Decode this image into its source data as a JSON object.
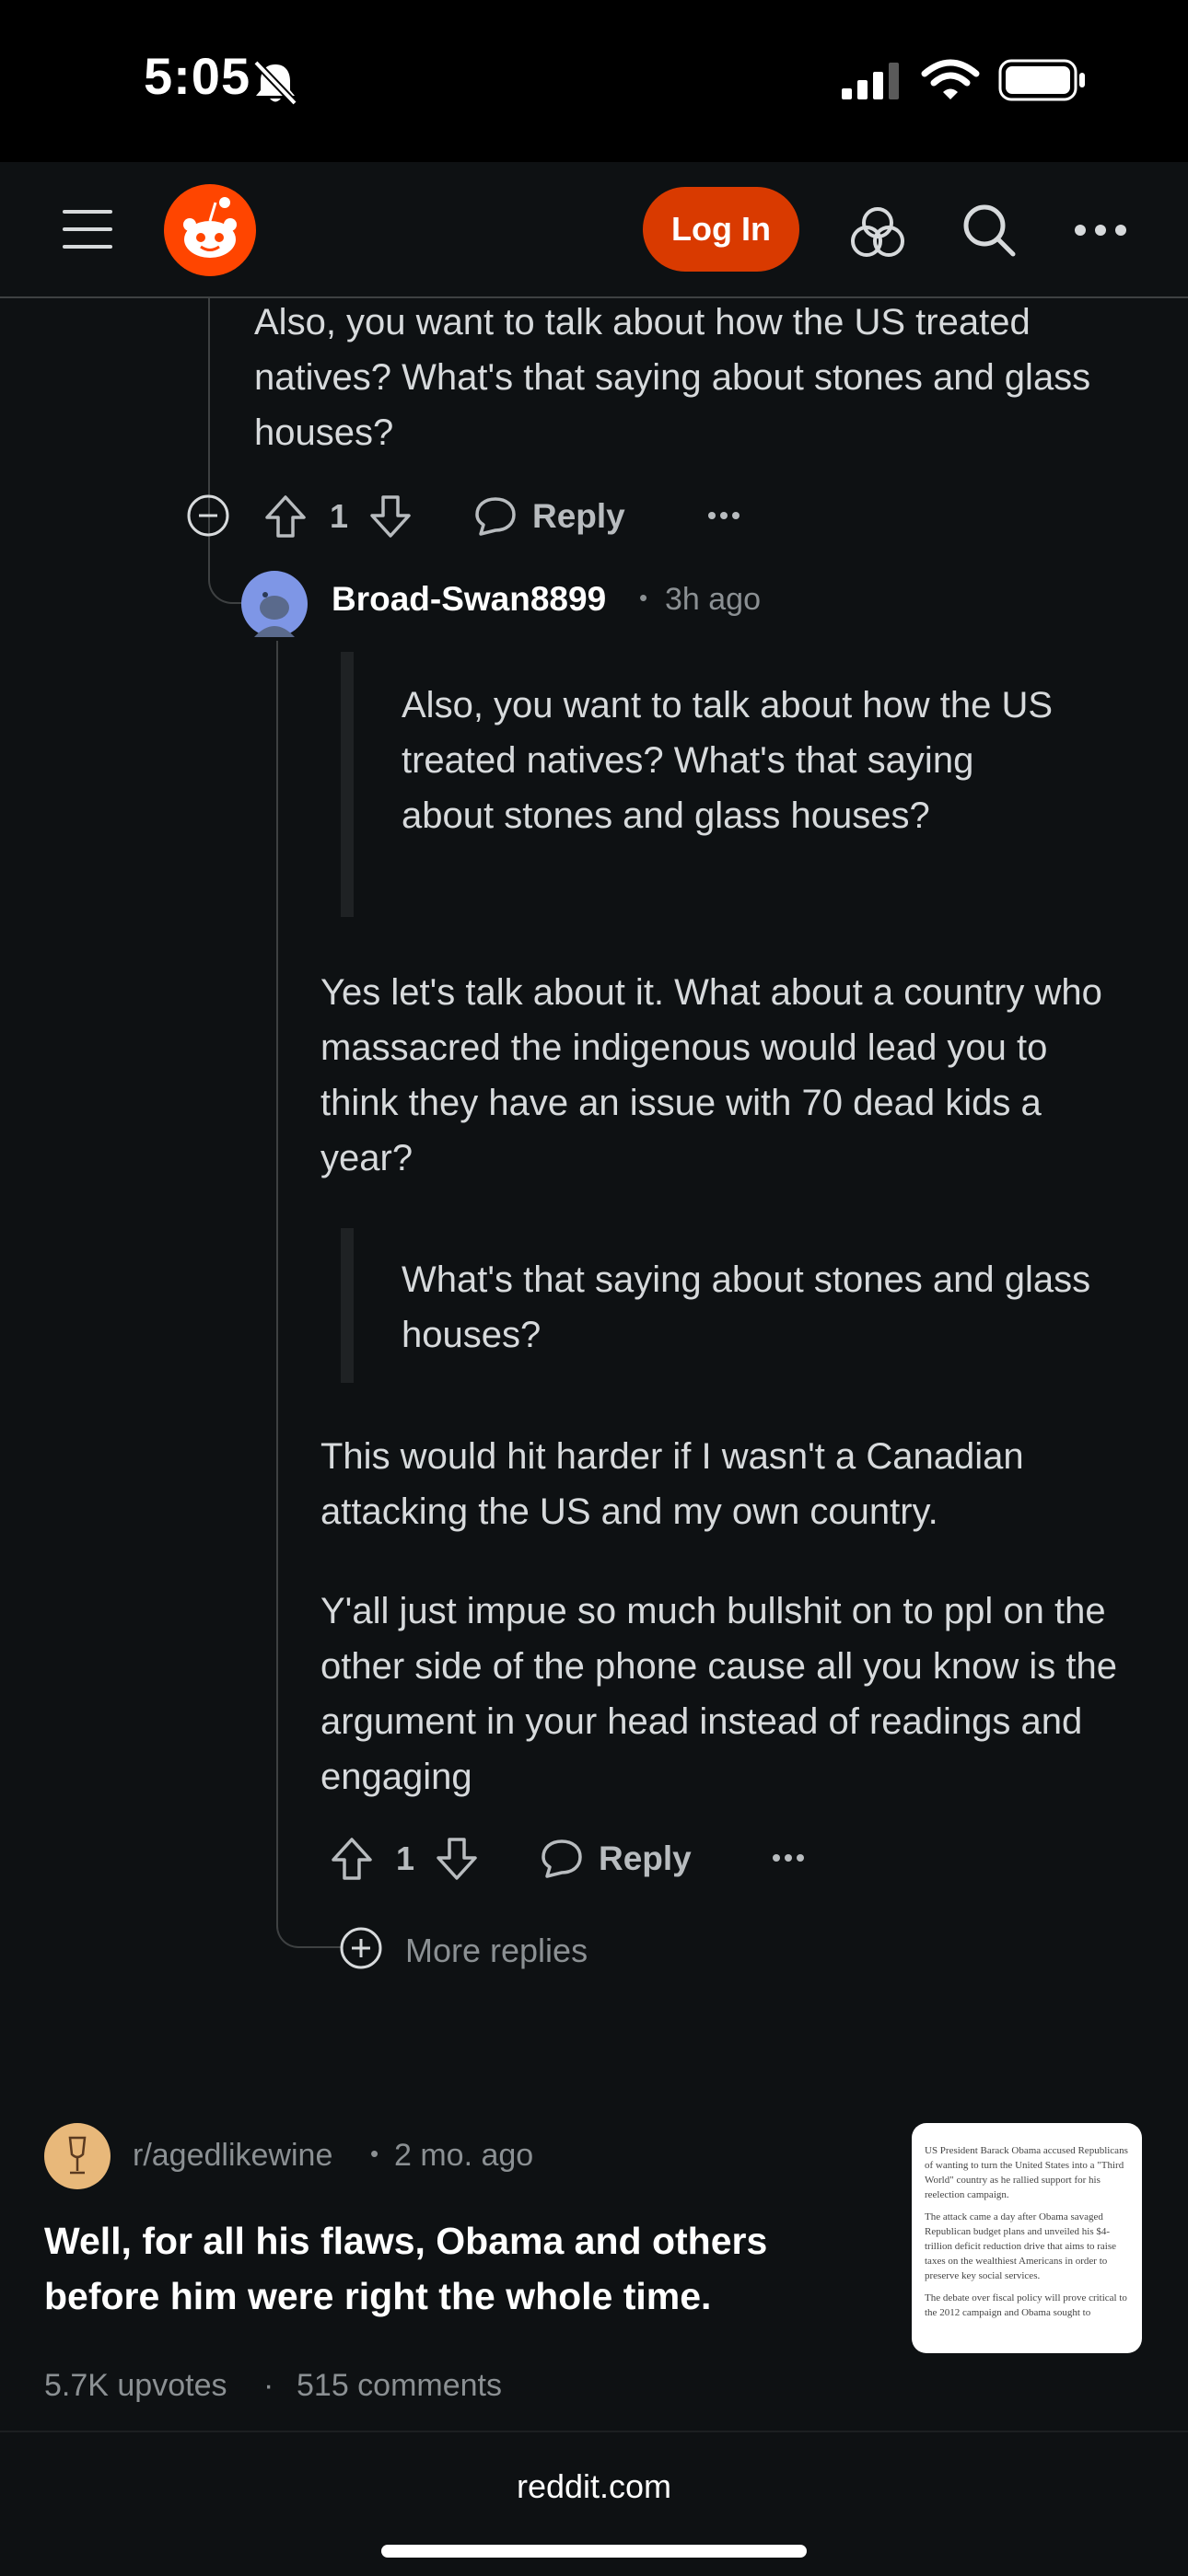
{
  "status": {
    "time": "5:05"
  },
  "header": {
    "login_label": "Log In"
  },
  "parent_comment": {
    "text": "Also, you want to talk about how the US treated natives? What's that saying about stones and glass houses?",
    "votes": "1",
    "reply_label": "Reply",
    "more": "···"
  },
  "reply": {
    "author": "Broad-Swan8899",
    "dot": "•",
    "time": "3h ago",
    "quote1": "Also, you want to talk about how the US treated natives? What's that saying about stones and glass houses?",
    "para1": "Yes let's talk about it. What about a country who massacred the indigenous would lead you to think they have an issue with 70 dead kids a year?",
    "quote2": "What's that saying about stones and glass houses?",
    "para2": "This would hit harder if I wasn't a Canadian attacking the US and my own country.",
    "para3": "Y'all just impue so much bullshit on to ppl on the other side of the phone cause all you know is the argument in your head instead of readings and engaging",
    "votes": "1",
    "reply_label": "Reply",
    "more": "···",
    "more_replies": "More replies"
  },
  "related_post": {
    "subreddit": "r/agedlikewine",
    "dot": "•",
    "age": "2 mo. ago",
    "title": "Well, for all his flaws, Obama and others before him were right the whole time.",
    "upvotes": "5.7K upvotes",
    "sep": "·",
    "comments": "515 comments",
    "thumbnail_text": {
      "p1": "US President Barack Obama accused Republicans of wanting to turn the United States into a \"Third World\" country as he rallied support for his reelection campaign.",
      "p2": "The attack came a day after Obama savaged Republican budget plans and unveiled his $4-trillion deficit reduction drive that aims to raise taxes on the wealthiest Americans in order to preserve key social services.",
      "p3": "The debate over fiscal policy will prove critical to the 2012 campaign and Obama sought to"
    }
  },
  "footer": {
    "domain": "reddit.com"
  }
}
